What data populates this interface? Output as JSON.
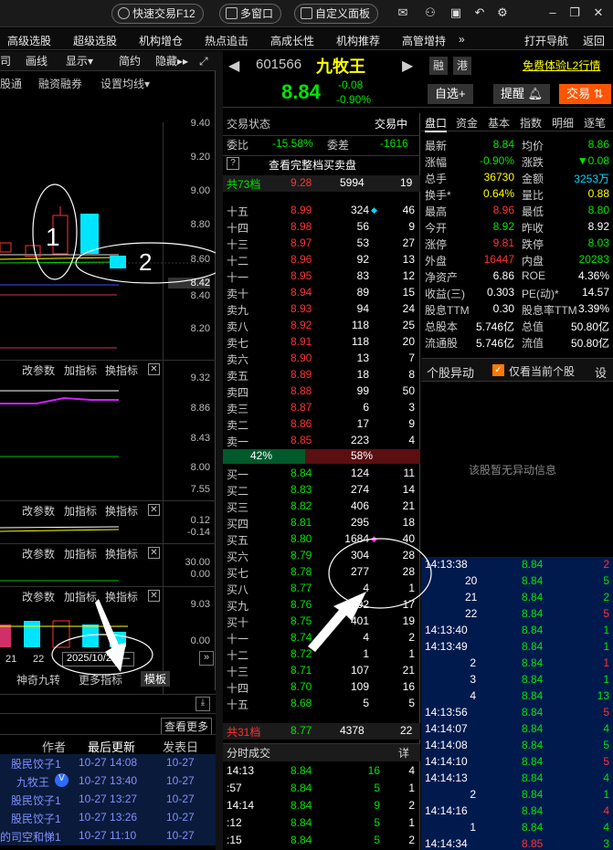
{
  "topbar": {
    "quick_trade": "快速交易F12",
    "multi_window": "多窗口",
    "custom_panel": "自定义面板"
  },
  "menu": [
    "高级选股",
    "超级选股",
    "机构增仓",
    "热点追击",
    "高成长性",
    "机构推荐",
    "高管增持",
    "»",
    "打开导航",
    "返回"
  ],
  "left": {
    "tabs": [
      "司",
      "画线",
      "显示▾",
      "简约",
      "隐藏▸▸"
    ],
    "subtabs": [
      "股通",
      "融资融券",
      "设置均线▾"
    ],
    "yaxis_main": [
      "9.40",
      "9.20",
      "9.00",
      "8.80",
      "8.60",
      "8.42",
      "8.40",
      "8.20"
    ],
    "annotation_1": "1",
    "annotation_2": "2",
    "ind1": {
      "params": "改参数",
      "add": "加指标",
      "swap": "换指标",
      "y": [
        "9.32",
        "8.86",
        "8.43",
        "8.00",
        "7.55"
      ]
    },
    "ind2": {
      "params": "改参数",
      "add": "加指标",
      "swap": "换指标",
      "y": [
        "0.12",
        "-0.14"
      ]
    },
    "ind3": {
      "params": "改参数",
      "add": "加指标",
      "swap": "换指标",
      "y": [
        "30.00",
        "0.00"
      ]
    },
    "ind4": {
      "params": "改参数",
      "add": "加指标",
      "swap": "换指标",
      "y": [
        "9.03",
        "0.00"
      ]
    },
    "x_labels": [
      "21",
      "22"
    ],
    "date_box": "2025/10/27/—",
    "bottom_tabs": [
      "神奇九转",
      "更多指标",
      "模板"
    ],
    "see_more": "查看更多",
    "list_header": [
      "作者",
      "最后更新",
      "发表日"
    ],
    "list": [
      {
        "author": "股民饺子1",
        "update": "10-27 14:08",
        "date": "10-27"
      },
      {
        "author": "九牧王",
        "update": "10-27 13:40",
        "date": "10-27"
      },
      {
        "author": "股民饺子1",
        "update": "10-27 13:27",
        "date": "10-27"
      },
      {
        "author": "股民饺子1",
        "update": "10-27 13:26",
        "date": "10-27"
      },
      {
        "author": "的司空和悌1",
        "update": "10-27 11:10",
        "date": "10-27"
      }
    ]
  },
  "stock": {
    "code": "601566",
    "name": "九牧王",
    "price": "8.84",
    "change": "-0.08",
    "change_pct": "-0.90%",
    "tag_rong": "融",
    "tag_gang": "港",
    "free_l2": "免费体验L2行情",
    "btn_watch": "自选+",
    "btn_alert": "提醒",
    "btn_trade": "交易"
  },
  "book": {
    "status_label": "交易状态",
    "status_value": "交易中",
    "weibi_label": "委比",
    "weibi_value": "-15.58%",
    "weicha_label": "委差",
    "weicha_value": "-1616",
    "full_queue": "查看完整档买卖盘",
    "sell_total": {
      "label": "共73档",
      "price": "9.28",
      "vol": "5994",
      "n": "19"
    },
    "sells": [
      {
        "l": "十五",
        "p": "8.99",
        "v": "324",
        "n": "46",
        "dot": "cyan"
      },
      {
        "l": "十四",
        "p": "8.98",
        "v": "56",
        "n": "9"
      },
      {
        "l": "十三",
        "p": "8.97",
        "v": "53",
        "n": "27"
      },
      {
        "l": "十二",
        "p": "8.96",
        "v": "92",
        "n": "13"
      },
      {
        "l": "十一",
        "p": "8.95",
        "v": "83",
        "n": "12"
      },
      {
        "l": "卖十",
        "p": "8.94",
        "v": "89",
        "n": "15"
      },
      {
        "l": "卖九",
        "p": "8.93",
        "v": "94",
        "n": "24"
      },
      {
        "l": "卖八",
        "p": "8.92",
        "v": "118",
        "n": "25"
      },
      {
        "l": "卖七",
        "p": "8.91",
        "v": "118",
        "n": "20"
      },
      {
        "l": "卖六",
        "p": "8.90",
        "v": "13",
        "n": "7"
      },
      {
        "l": "卖五",
        "p": "8.89",
        "v": "18",
        "n": "8"
      },
      {
        "l": "卖四",
        "p": "8.88",
        "v": "99",
        "n": "50"
      },
      {
        "l": "卖三",
        "p": "8.87",
        "v": "6",
        "n": "3"
      },
      {
        "l": "卖二",
        "p": "8.86",
        "v": "17",
        "n": "9"
      },
      {
        "l": "卖一",
        "p": "8.85",
        "v": "223",
        "n": "4"
      }
    ],
    "ratio_sell": "42%",
    "ratio_buy": "58%",
    "buys": [
      {
        "l": "买一",
        "p": "8.84",
        "v": "124",
        "n": "11"
      },
      {
        "l": "买二",
        "p": "8.83",
        "v": "274",
        "n": "14"
      },
      {
        "l": "买三",
        "p": "8.82",
        "v": "406",
        "n": "21"
      },
      {
        "l": "买四",
        "p": "8.81",
        "v": "295",
        "n": "18"
      },
      {
        "l": "买五",
        "p": "8.80",
        "v": "1684",
        "n": "40",
        "dot": "pink"
      },
      {
        "l": "买六",
        "p": "8.79",
        "v": "304",
        "n": "28"
      },
      {
        "l": "买七",
        "p": "8.78",
        "v": "277",
        "n": "28"
      },
      {
        "l": "买八",
        "p": "8.77",
        "v": "4",
        "n": "1"
      },
      {
        "l": "买九",
        "p": "8.76",
        "v": "192",
        "n": "17"
      },
      {
        "l": "买十",
        "p": "8.75",
        "v": "401",
        "n": "19"
      },
      {
        "l": "十一",
        "p": "8.74",
        "v": "4",
        "n": "2"
      },
      {
        "l": "十二",
        "p": "8.72",
        "v": "1",
        "n": "1"
      },
      {
        "l": "十三",
        "p": "8.71",
        "v": "107",
        "n": "21"
      },
      {
        "l": "十四",
        "p": "8.70",
        "v": "109",
        "n": "16"
      },
      {
        "l": "十五",
        "p": "8.68",
        "v": "5",
        "n": "5"
      }
    ],
    "buy_total": {
      "label": "共31档",
      "price": "8.77",
      "vol": "4378",
      "n": "22"
    },
    "fenshi_label": "分时成交",
    "fenshi_detail": "详",
    "fenshi": [
      {
        "t": "14:13",
        "p": "8.84",
        "v": "16",
        "n": "4"
      },
      {
        "t": ":57",
        "p": "8.84",
        "v": "5",
        "n": "1"
      },
      {
        "t": "14:14",
        "p": "8.84",
        "v": "9",
        "n": "2"
      },
      {
        "t": ":12",
        "p": "8.84",
        "v": "5",
        "n": "1"
      },
      {
        "t": ":15",
        "p": "8.84",
        "v": "5",
        "n": "2"
      }
    ]
  },
  "panel": {
    "tabs": [
      "盘口",
      "资金",
      "基本",
      "指数",
      "明细",
      "逐笔"
    ],
    "quote": [
      [
        "最新",
        "8.84",
        "均价",
        "8.86"
      ],
      [
        "涨幅",
        "-0.90%",
        "涨跌",
        "▼0.08"
      ],
      [
        "总手",
        "36730",
        "金额",
        "3253万"
      ],
      [
        "换手*",
        "0.64%",
        "量比",
        "0.88"
      ],
      [
        "最高",
        "8.96",
        "最低",
        "8.80"
      ],
      [
        "今开",
        "8.92",
        "昨收",
        "8.92"
      ],
      [
        "涨停",
        "9.81",
        "跌停",
        "8.03"
      ],
      [
        "外盘",
        "16447",
        "内盘",
        "20283"
      ],
      [
        "净资产",
        "6.86",
        "ROE",
        "4.36%"
      ],
      [
        "收益(三)",
        "0.303",
        "PE(动)*",
        "14.57"
      ],
      [
        "股息TTM",
        "0.30",
        "股息率TTM",
        "3.39%"
      ],
      [
        "总股本",
        "5.746亿",
        "总值",
        "50.80亿"
      ],
      [
        "流通股",
        "5.746亿",
        "流值",
        "50.80亿"
      ]
    ],
    "abnormal_title": "个股异动",
    "only_current": "仅看当前个股",
    "settings": "设",
    "no_abnormal": "该股暂无异动信息",
    "ticks": [
      {
        "t": "14:13:38",
        "p": "8.84",
        "v": "2"
      },
      {
        "t": "20",
        "p": "8.84",
        "v": "5"
      },
      {
        "t": "21",
        "p": "8.84",
        "v": "2"
      },
      {
        "t": "22",
        "p": "8.84",
        "v": "5"
      },
      {
        "t": "14:13:40",
        "p": "8.84",
        "v": "1"
      },
      {
        "t": "14:13:49",
        "p": "8.84",
        "v": "1"
      },
      {
        "t": "2",
        "p": "8.84",
        "v": "1"
      },
      {
        "t": "3",
        "p": "8.84",
        "v": "1"
      },
      {
        "t": "4",
        "p": "8.84",
        "v": "13"
      },
      {
        "t": "14:13:56",
        "p": "8.84",
        "v": "5"
      },
      {
        "t": "14:14:07",
        "p": "8.84",
        "v": "4"
      },
      {
        "t": "14:14:08",
        "p": "8.84",
        "v": "5"
      },
      {
        "t": "14:14:10",
        "p": "8.84",
        "v": "5"
      },
      {
        "t": "14:14:13",
        "p": "8.84",
        "v": "4"
      },
      {
        "t": "2",
        "p": "8.84",
        "v": "1"
      },
      {
        "t": "14:14:16",
        "p": "8.84",
        "v": "4"
      },
      {
        "t": "1",
        "p": "8.84",
        "v": "4"
      },
      {
        "t": "14:14:34",
        "p": "8.85",
        "v": "3"
      }
    ]
  }
}
